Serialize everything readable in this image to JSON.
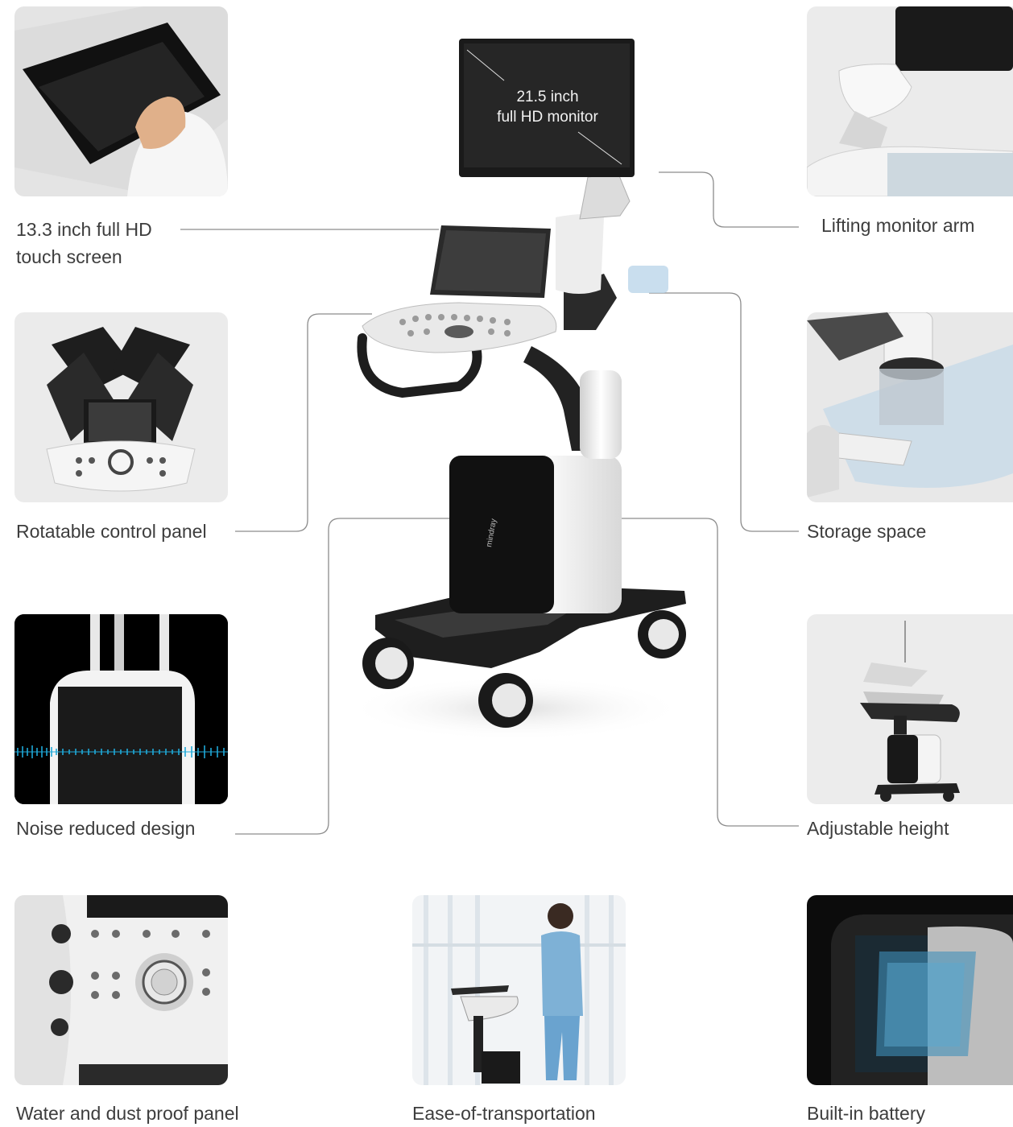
{
  "monitor_label": {
    "line1": "21.5 inch",
    "line2": "full HD monitor"
  },
  "features": [
    {
      "label": "13.3 inch full HD",
      "label2": "touch screen"
    },
    {
      "label": "Lifting monitor arm"
    },
    {
      "label": "Rotatable control panel"
    },
    {
      "label": "Storage space"
    },
    {
      "label": "Noise reduced design"
    },
    {
      "label": "Adjustable height"
    },
    {
      "label": "Water and dust proof panel"
    },
    {
      "label": "Ease-of-transportation"
    },
    {
      "label": "Built-in battery"
    }
  ],
  "colors": {
    "text": "#3d3d3d",
    "leader_line": "#8c8c8c",
    "tile_light": "#e6e6e6",
    "tile_dark": "#0a0a0a",
    "noise_wave": "#1fa8d8"
  }
}
